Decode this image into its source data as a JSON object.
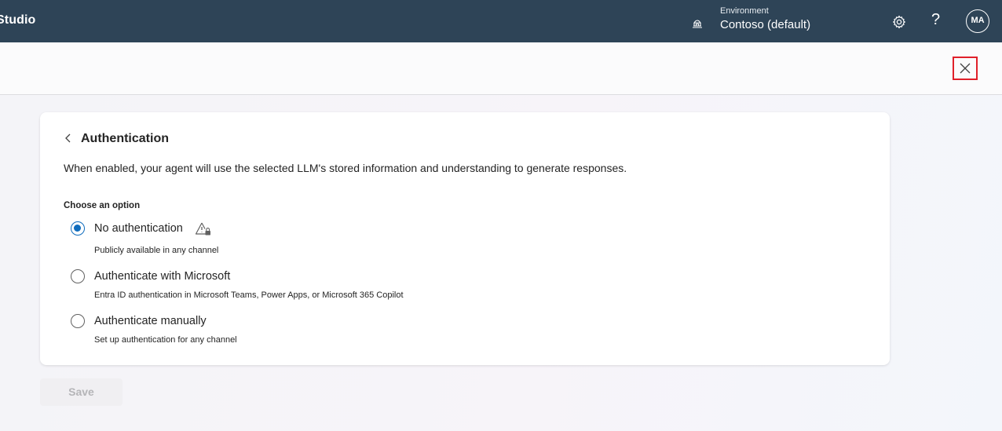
{
  "topbar": {
    "app_title": "Studio",
    "environment_label": "Environment",
    "environment_value": "Contoso (default)",
    "help_glyph": "?",
    "avatar_initials": "MA"
  },
  "page": {
    "title": "Authentication",
    "description": "When enabled, your agent will use the selected LLM's stored information and understanding to generate responses.",
    "choose_label": "Choose an option",
    "options": [
      {
        "label": "No authentication",
        "description": "Publicly available in any channel",
        "selected": true
      },
      {
        "label": "Authenticate with Microsoft",
        "description": "Entra ID authentication in Microsoft Teams, Power Apps, or Microsoft 365 Copilot",
        "selected": false
      },
      {
        "label": "Authenticate manually",
        "description": "Set up authentication for any channel",
        "selected": false
      }
    ],
    "save_label": "Save"
  },
  "icons": {
    "environment": "environment-icon",
    "settings": "gear-icon",
    "close": "close-icon",
    "back": "chevron-left-icon",
    "warning": "warning-lock-icon"
  },
  "colors": {
    "topbar": "#2e4457",
    "accent": "#0f6cbd",
    "close_highlight": "#e0202a"
  }
}
